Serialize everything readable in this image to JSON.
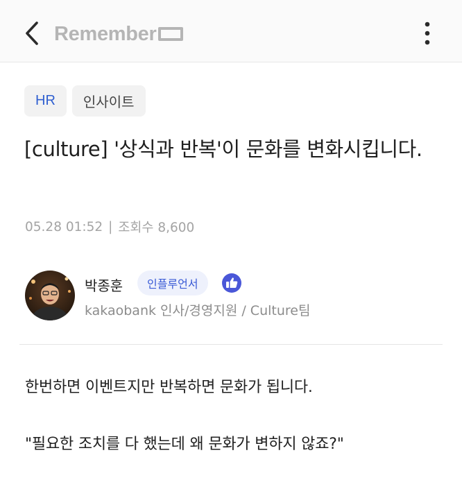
{
  "header": {
    "back_icon": "chevron-left-icon",
    "brand": "Remember",
    "more_icon": "vertical-dots-icon"
  },
  "tags": [
    {
      "label": "HR",
      "color": "#2f5fd0"
    },
    {
      "label": "인사이트",
      "color": "#444444"
    }
  ],
  "article": {
    "title": "[culture] '상식과 반복'이 문화를 변화시킵니다.",
    "date": "05.28 01:52",
    "views_label": "조회수 8,600"
  },
  "author": {
    "name": "박종훈",
    "badge": "인플루언서",
    "badge_icon": "thumbs-up-icon",
    "affiliation": "kakaobank 인사/경영지원 / Culture팀"
  },
  "body": {
    "paragraph_1": "한번하면 이벤트지만 반복하면 문화가 됩니다.",
    "paragraph_2": "\"필요한 조치를 다 했는데 왜 문화가 변하지 않죠?\""
  },
  "colors": {
    "accent": "#3a5bd6",
    "brand_gray": "#b5b5b5",
    "meta_gray": "#a4a4a4"
  }
}
